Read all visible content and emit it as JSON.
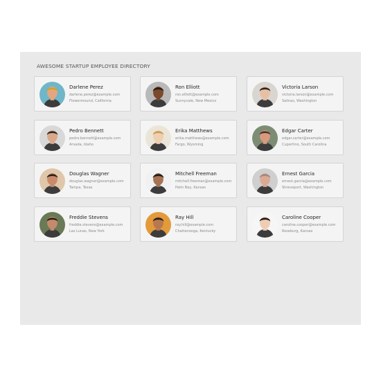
{
  "directory": {
    "title": "AWESOME STARTUP EMPLOYEE DIRECTORY",
    "employees": [
      {
        "name": "Darlene Perez",
        "email": "darlene.perez@example.com",
        "location": "Flowermound, California",
        "avatar": {
          "icon": "person-avatar-icon",
          "bg": "#6fb6c8",
          "skin": "#e2a77f",
          "hair": "#d1a02a"
        }
      },
      {
        "name": "Ron Elliott",
        "email": "ron.elliott@example.com",
        "location": "Sunnyvale, New Mexico",
        "avatar": {
          "icon": "person-avatar-icon",
          "bg": "#b9b9b9",
          "skin": "#7a4a2d",
          "hair": "#2b1a12"
        }
      },
      {
        "name": "Victoria Larson",
        "email": "victoria.larson@example.com",
        "location": "Salinas, Washington",
        "avatar": {
          "icon": "person-avatar-icon",
          "bg": "#d9d6d2",
          "skin": "#e7c0a3",
          "hair": "#2a2420"
        }
      },
      {
        "name": "Pedro Bennett",
        "email": "pedro.bennett@example.com",
        "location": "Arvada, Idaho",
        "avatar": {
          "icon": "person-avatar-icon",
          "bg": "#d8d8d8",
          "skin": "#d9a98a",
          "hair": "#2c2622"
        }
      },
      {
        "name": "Erika Matthews",
        "email": "erika.matthews@example.com",
        "location": "Fargo, Wyoming",
        "avatar": {
          "icon": "person-avatar-icon",
          "bg": "#ebe5d8",
          "skin": "#efcfb0",
          "hair": "#c99a53"
        }
      },
      {
        "name": "Edgar Carter",
        "email": "edgar.carter@example.com",
        "location": "Cupertino, South Carolina",
        "avatar": {
          "icon": "person-avatar-icon",
          "bg": "#7c8d74",
          "skin": "#d79a7f",
          "hair": "#4b3226"
        }
      },
      {
        "name": "Douglas Wagner",
        "email": "douglas.wagner@example.com",
        "location": "Tampa, Texas",
        "avatar": {
          "icon": "person-avatar-icon",
          "bg": "#e0c7a9",
          "skin": "#c98b6c",
          "hair": "#2a2018"
        }
      },
      {
        "name": "Mitchell Freeman",
        "email": "mitchell.freeman@example.com",
        "location": "Palm Bay, Kansas",
        "avatar": {
          "icon": "person-avatar-icon",
          "bg": "#f1f1f1",
          "skin": "#a67454",
          "hair": "#1f1a17"
        }
      },
      {
        "name": "Ernest Garcia",
        "email": "ernest.garcia@example.com",
        "location": "Shreveport, Washington",
        "avatar": {
          "icon": "person-avatar-icon",
          "bg": "#cfcfcf",
          "skin": "#dcaa94",
          "hair": "#9b8a80"
        }
      },
      {
        "name": "Freddie Stevens",
        "email": "freddie.stevens@example.com",
        "location": "Las Lunas, New York",
        "avatar": {
          "icon": "person-avatar-icon",
          "bg": "#6a7a56",
          "skin": "#c48a6c",
          "hair": "#2a1d16"
        }
      },
      {
        "name": "Ray Hill",
        "email": "ray.hill@example.com",
        "location": "Chattanooga, Kentucky",
        "avatar": {
          "icon": "person-avatar-icon",
          "bg": "#e39a3b",
          "skin": "#b8784f",
          "hair": "#2a1d12"
        }
      },
      {
        "name": "Caroline Cooper",
        "email": "caroline.cooper@example.com",
        "location": "Roseburg, Kansas",
        "avatar": {
          "icon": "person-avatar-icon",
          "bg": "#f6f6f6",
          "skin": "#efcdb4",
          "hair": "#1f1814"
        }
      }
    ]
  }
}
